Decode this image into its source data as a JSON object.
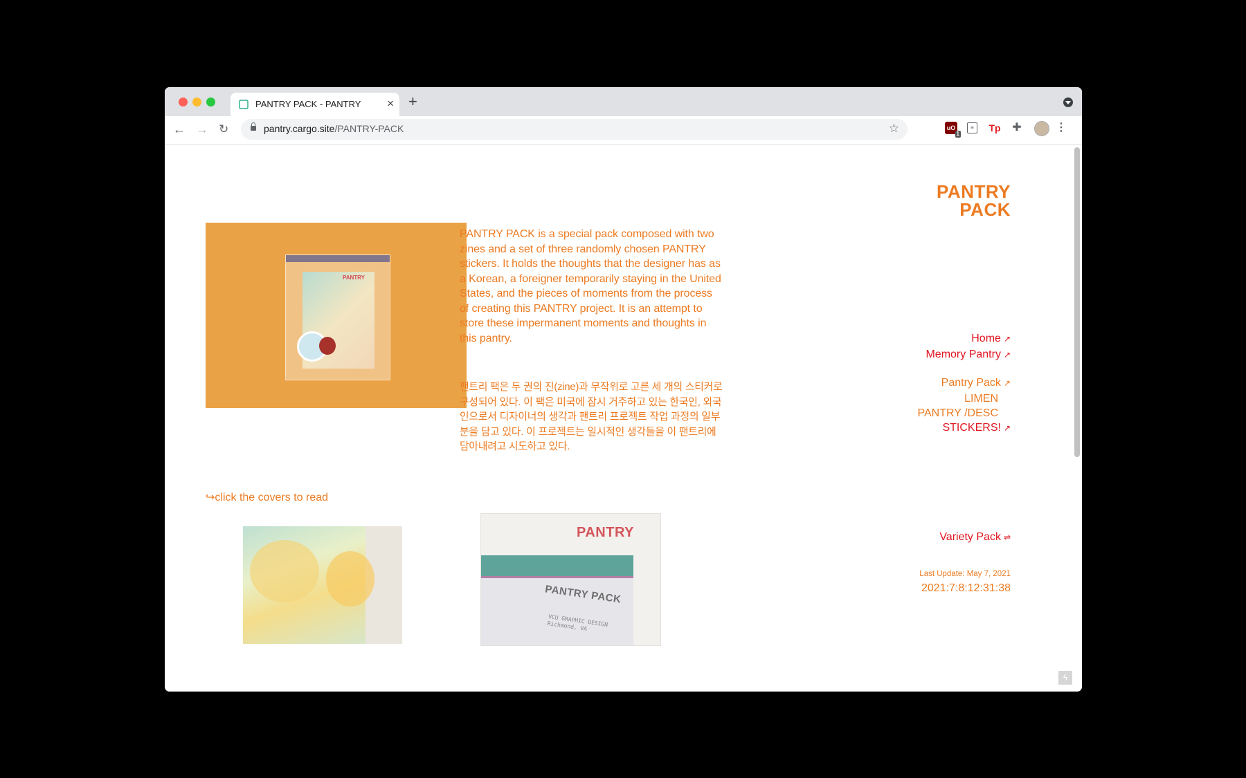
{
  "browser": {
    "tab_title": "PANTRY PACK - PANTRY",
    "url_host": "pantry.cargo.site",
    "url_path": "/PANTRY-PACK",
    "ublock_count": "1",
    "reader_icon": "reader-icon",
    "extension_tp": "Tp",
    "new_tab": "+",
    "tab_close": "×"
  },
  "site": {
    "logo_line1": "PANTRY",
    "logo_line2": "PACK",
    "accent_color": "#ec7b22",
    "link_color": "#e0151f"
  },
  "content": {
    "description_en": "PANTRY PACK is a special pack composed with two zines and a set of three randomly chosen PANTRY stickers. It holds the thoughts that the designer has as a Korean, a foreigner temporarily staying in the United States, and the pieces of moments from the process of creating this PANTRY project. It is an attempt to store these impermanent moments and thoughts in this pantry.",
    "description_ko": "팬트리 팩은 두 권의 진(zine)과 무작위로 고른 세 개의 스티커로 구성되어 있다. 이 팩은 미국에 잠시 거주하고 있는 한국인, 외국인으로서 디자이너의 생각과 팬트리 프로젝트 작업 과정의 일부분을 담고 있다. 이 프로젝트는 일시적인 생각들을 이 팬트리에 담아내려고 시도하고 있다.",
    "click_hint": "↪click the covers to read",
    "bag_zine_title": "PANTRY",
    "cover2_title": "PANTRY",
    "cover2_pack": "PANTRY PACK",
    "cover2_small_line1": "VCU GRAPHIC DESIGN",
    "cover2_small_line2": "Richmond, VA"
  },
  "menu": {
    "home": "Home",
    "memory_pantry": "Memory Pantry",
    "pantry_pack": "Pantry Pack",
    "limen": "LIMEN",
    "pantry_desc": "PANTRY /DESC",
    "stickers": "STICKERS!",
    "variety_pack": "Variety Pack",
    "arrow": "↗",
    "loop_arrow": "⇌"
  },
  "footer": {
    "last_update": "Last Update: May 7, 2021",
    "timestamp": "2021:7:8:12:31:38"
  }
}
